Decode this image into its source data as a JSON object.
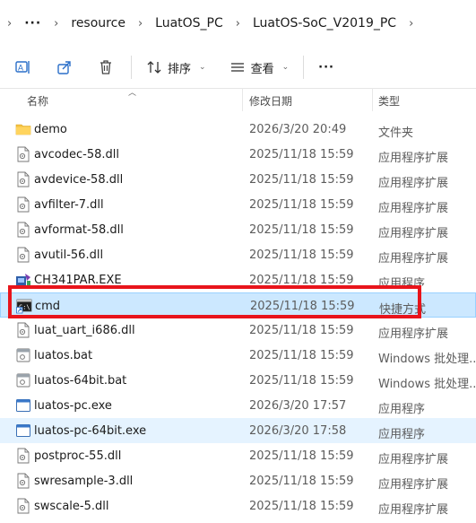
{
  "breadcrumb": {
    "overflow": "···",
    "segments": [
      "resource",
      "LuatOS_PC",
      "LuatOS-SoC_V2019_PC"
    ]
  },
  "toolbar": {
    "sort_label": "排序",
    "view_label": "查看",
    "more_label": "···"
  },
  "columns": {
    "name": "名称",
    "date": "修改日期",
    "type": "类型"
  },
  "files": [
    {
      "name": "demo",
      "date": "2026/3/20 20:49",
      "type": "文件夹",
      "icon": "folder-icon"
    },
    {
      "name": "avcodec-58.dll",
      "date": "2025/11/18 15:59",
      "type": "应用程序扩展",
      "icon": "dll-file-icon"
    },
    {
      "name": "avdevice-58.dll",
      "date": "2025/11/18 15:59",
      "type": "应用程序扩展",
      "icon": "dll-file-icon"
    },
    {
      "name": "avfilter-7.dll",
      "date": "2025/11/18 15:59",
      "type": "应用程序扩展",
      "icon": "dll-file-icon"
    },
    {
      "name": "avformat-58.dll",
      "date": "2025/11/18 15:59",
      "type": "应用程序扩展",
      "icon": "dll-file-icon"
    },
    {
      "name": "avutil-56.dll",
      "date": "2025/11/18 15:59",
      "type": "应用程序扩展",
      "icon": "dll-file-icon"
    },
    {
      "name": "CH341PAR.EXE",
      "date": "2025/11/18 15:59",
      "type": "应用程序",
      "icon": "installer-exe-icon"
    },
    {
      "name": "cmd",
      "date": "2025/11/18 15:59",
      "type": "快捷方式",
      "icon": "cmd-shortcut-icon"
    },
    {
      "name": "luat_uart_i686.dll",
      "date": "2025/11/18 15:59",
      "type": "应用程序扩展",
      "icon": "dll-file-icon"
    },
    {
      "name": "luatos.bat",
      "date": "2025/11/18 15:59",
      "type": "Windows 批处理...",
      "icon": "bat-file-icon"
    },
    {
      "name": "luatos-64bit.bat",
      "date": "2025/11/18 15:59",
      "type": "Windows 批处理...",
      "icon": "bat-file-icon"
    },
    {
      "name": "luatos-pc.exe",
      "date": "2026/3/20 17:57",
      "type": "应用程序",
      "icon": "exe-app-icon"
    },
    {
      "name": "luatos-pc-64bit.exe",
      "date": "2026/3/20 17:58",
      "type": "应用程序",
      "icon": "exe-app-icon"
    },
    {
      "name": "postproc-55.dll",
      "date": "2025/11/18 15:59",
      "type": "应用程序扩展",
      "icon": "dll-file-icon"
    },
    {
      "name": "swresample-3.dll",
      "date": "2025/11/18 15:59",
      "type": "应用程序扩展",
      "icon": "dll-file-icon"
    },
    {
      "name": "swscale-5.dll",
      "date": "2025/11/18 15:59",
      "type": "应用程序扩展",
      "icon": "dll-file-icon"
    }
  ],
  "selected_index": 7,
  "hover_index": 12,
  "colors": {
    "selection": "#cce8ff",
    "hover": "#e5f3ff",
    "highlight": "#e8141b",
    "folder": "#f5c242"
  }
}
